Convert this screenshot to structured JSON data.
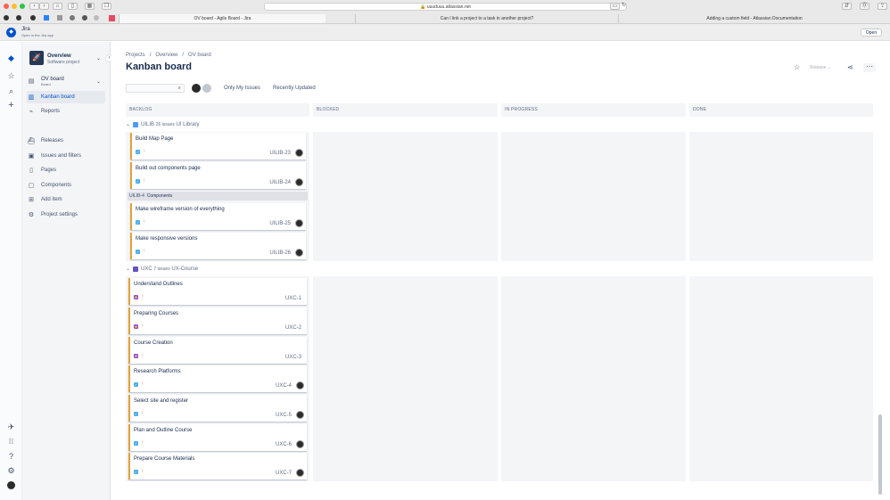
{
  "browser": {
    "url": "uuuduuu.atlassian.net",
    "tabs": [
      "OV board - Agile Board - Jira",
      "Can I link a project to a task in another project?",
      "Adding a custom field - Atlassian Documentation"
    ]
  },
  "banner": {
    "app_name": "Jira",
    "subtitle": "Open in the Jira app",
    "open_label": "Open"
  },
  "sidebar": {
    "project_name": "Overview",
    "project_type": "Software project",
    "board_name": "OV board",
    "board_sub": "Board",
    "items": [
      "Kanban board",
      "Reports",
      "Releases",
      "Issues and filters",
      "Pages",
      "Components",
      "Add item",
      "Project settings"
    ]
  },
  "breadcrumbs": [
    "Projects",
    "/",
    "Overview",
    "/",
    "OV board"
  ],
  "page_title": "Kanban board",
  "header": {
    "release_label": "Release"
  },
  "filters": {
    "search_placeholder": "",
    "only_my_issues": "Only My Issues",
    "recently_updated": "Recently Updated"
  },
  "columns": [
    "BACKLOG",
    "BLOCKED",
    "IN PROGRESS",
    "DONE"
  ],
  "swimlanes": [
    {
      "key": "UILIB",
      "count": "26 issues",
      "name": "UI Library"
    },
    {
      "key": "UXC",
      "count": "7 issues",
      "name": "UX-Course"
    }
  ],
  "epic_group": {
    "key": "UILIB-4",
    "name": "Components"
  },
  "cards": [
    {
      "title": "Build Map Page",
      "key": "UILIB-23"
    },
    {
      "title": "Build out components page",
      "key": "UILIB-24"
    },
    {
      "title": "Make wireframe version of everything",
      "key": "UILIB-25"
    },
    {
      "title": "Make responsive versions",
      "key": "UILIB-26"
    },
    {
      "title": "Understand Outlines",
      "key": "UXC-1"
    },
    {
      "title": "Preparing Courses",
      "key": "UXC-2"
    },
    {
      "title": "Course Creation",
      "key": "UXC-3"
    },
    {
      "title": "Research Platforms",
      "key": "UXC-4"
    },
    {
      "title": "Select site and register",
      "key": "UXC-5"
    },
    {
      "title": "Plan and Outline Course",
      "key": "UXC-6"
    },
    {
      "title": "Prepare Course Materials",
      "key": "UXC-7"
    }
  ],
  "colors": {
    "accent": "#0052CC",
    "nav_bg": "#F4F5F7",
    "card_stripe": "#e0a33a",
    "story": "#4BADE8",
    "epic": "#904EE2",
    "priority": "#FF7452"
  }
}
